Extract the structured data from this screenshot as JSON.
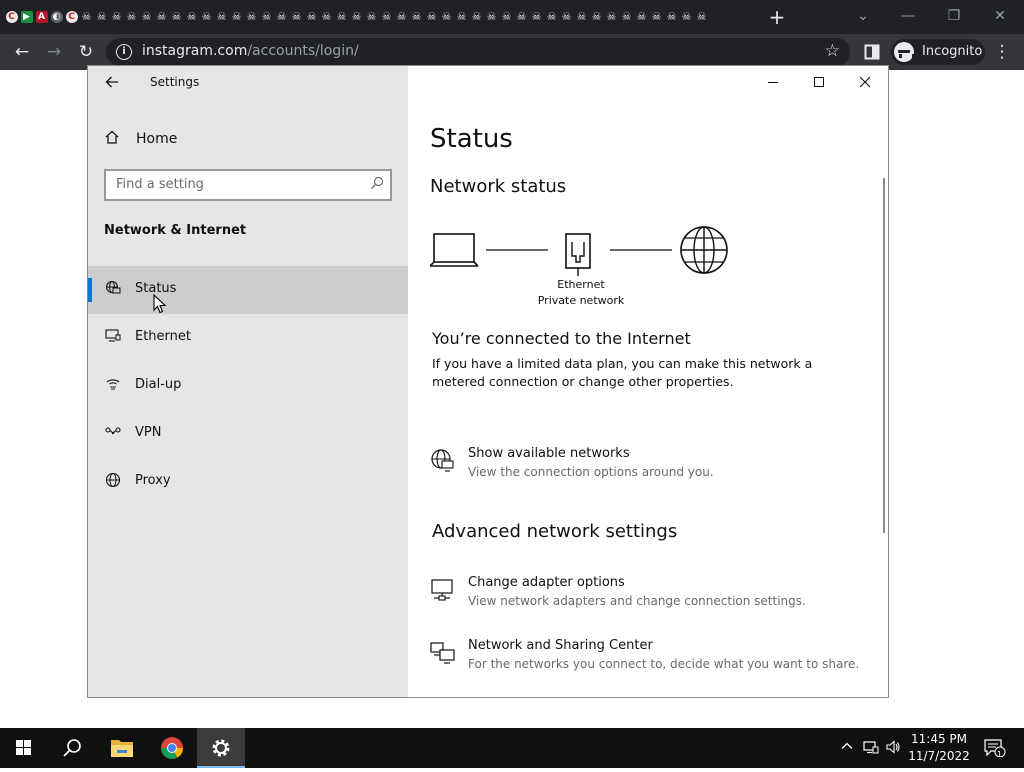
{
  "browser": {
    "url_domain": "instagram.com",
    "url_path": "/accounts/login/",
    "incognito_label": "Incognito",
    "new_tab_symbol": "+",
    "tabs": [
      "c",
      "play",
      "a",
      "moon",
      "c",
      "skull",
      "skull",
      "skull",
      "skull",
      "skull",
      "skull",
      "skull",
      "skull",
      "skull",
      "skull",
      "skull",
      "skull",
      "skull",
      "skull",
      "skull",
      "skull",
      "skull",
      "skull",
      "skull",
      "skull",
      "skull",
      "skull",
      "skull",
      "skull",
      "skull",
      "skull",
      "skull",
      "skull",
      "skull",
      "skull",
      "skull",
      "skull",
      "skull",
      "skull",
      "skull",
      "skull",
      "skull",
      "skull",
      "skull",
      "skull",
      "skull",
      "skull"
    ],
    "tab_glyphs": {
      "c": "C",
      "play": "▶",
      "a": "A",
      "moon": "◐",
      "skull": "☠"
    }
  },
  "window": {
    "title": "Settings"
  },
  "sidebar": {
    "home_label": "Home",
    "search_placeholder": "Find a setting",
    "section_title": "Network & Internet",
    "items": [
      {
        "label": "Status",
        "icon": "globe-monitor-icon",
        "active": true
      },
      {
        "label": "Ethernet",
        "icon": "ethernet-monitor-icon",
        "active": false
      },
      {
        "label": "Dial-up",
        "icon": "dialup-icon",
        "active": false
      },
      {
        "label": "VPN",
        "icon": "vpn-icon",
        "active": false
      },
      {
        "label": "Proxy",
        "icon": "globe-icon",
        "active": false
      }
    ]
  },
  "main": {
    "title": "Status",
    "network_status_heading": "Network status",
    "diagram": {
      "adapter_label": "Ethernet",
      "network_label": "Private network"
    },
    "connected_heading": "You’re connected to the Internet",
    "connected_description": "If you have a limited data plan, you can make this network a metered connection or change other properties.",
    "show_networks": {
      "title": "Show available networks",
      "subtitle": "View the connection options around you."
    },
    "advanced_heading": "Advanced network settings",
    "adapter_options": {
      "title": "Change adapter options",
      "subtitle": "View network adapters and change connection settings."
    },
    "sharing_center": {
      "title": "Network and Sharing Center",
      "subtitle": "For the networks you connect to, decide what you want to share."
    }
  },
  "taskbar": {
    "time": "11:45 PM",
    "date": "11/7/2022",
    "notification_count": "1"
  },
  "colors": {
    "accent": "#0078d4",
    "chrome_dark": "#202124",
    "sidebar_bg": "#e6e6e6"
  }
}
